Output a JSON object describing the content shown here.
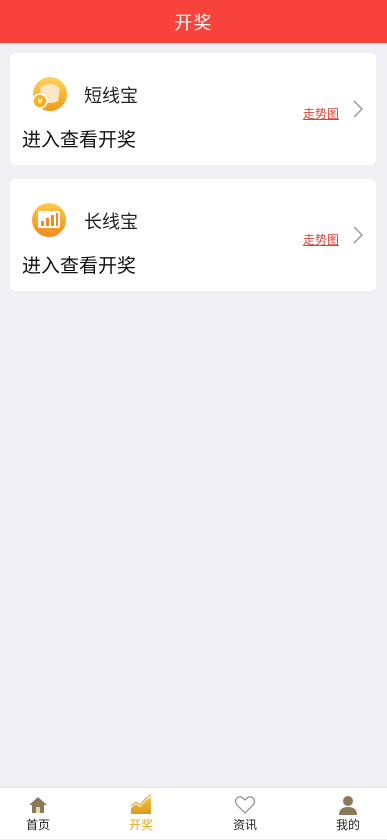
{
  "header": {
    "title": "开奖"
  },
  "cards": [
    {
      "name": "短线宝",
      "enter_label": "进入查看开奖",
      "trend_label": "走势图",
      "icon": "coin-wallet-icon"
    },
    {
      "name": "长线宝",
      "enter_label": "进入查看开奖",
      "trend_label": "走势图",
      "icon": "bar-chart-icon"
    }
  ],
  "tabbar": {
    "items": [
      {
        "label": "首页",
        "icon": "home-icon",
        "active": false
      },
      {
        "label": "开奖",
        "icon": "trend-chart-icon",
        "active": true
      },
      {
        "label": "资讯",
        "icon": "heart-icon",
        "active": false
      },
      {
        "label": "我的",
        "icon": "user-icon",
        "active": false
      }
    ]
  },
  "colors": {
    "header_bg": "#f7433c",
    "page_bg": "#efeff4",
    "active_tab": "#e0a928",
    "trend_link": "#d9443a"
  }
}
